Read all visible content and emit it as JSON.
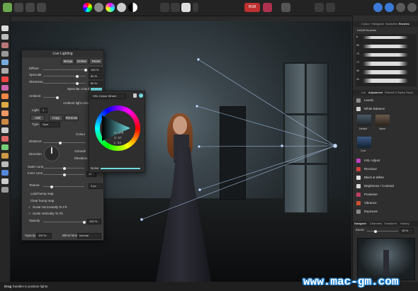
{
  "toolbar": {
    "icons": [
      "persona-photo-icon",
      "persona-liquify-icon",
      "persona-develop-icon",
      "persona-tonemap-icon",
      "persona-export-icon",
      "color-wheel-icon",
      "levels-icon",
      "hsl-icon",
      "white-balance-icon",
      "auto-contrast-icon",
      "select-rect-icon",
      "select-ellipse-icon",
      "mask-icon",
      "rgb-icon",
      "quick-mask-icon",
      "refine-icon",
      "assistant-icon",
      "snapping-icon",
      "arrange-icon",
      "view-mode-icon"
    ],
    "channel_label": "RGB"
  },
  "live_lighting": {
    "title": "Live Lighting",
    "merge": "Merge",
    "delete": "Delete",
    "reset": "Reset",
    "diffuse_label": "Diffuse",
    "diffuse_value": "100 %",
    "specular_label": "Specular",
    "specular_value": "80 %",
    "shininess_label": "Shininess",
    "shininess_value": "80 %",
    "specular_colour_label": "Specular colour",
    "ambient_label": "Ambient",
    "ambient_light_colour_label": "Ambient light colour",
    "light_label": "Light",
    "light_value": "1",
    "add": "Add",
    "copy": "Copy",
    "remove": "Remove",
    "type_label": "Type",
    "type_value": "Spot",
    "colour_label": "Colour",
    "distance_label": "Distance",
    "direction_label": "Direction",
    "azimuth_label": "Azimuth",
    "elevation_label": "Elevation",
    "outer_cone_label": "Outer cone",
    "inner_cone_label": "Inner cone",
    "inner_cone_value": "16 °",
    "texture_label": "Texture",
    "texture_value": "9 px",
    "load_bump_map": "Load bump map",
    "clear_bump_map": "Clear bump map",
    "scale_h": "Scale Horizontally To Fit",
    "scale_v": "Scale Vertically To Fit",
    "opacity_slider_label": "Opacity",
    "opacity_slider_value": "100 %",
    "opacity_label": "Opacity",
    "opacity_value": "100 %",
    "blend_mode_label": "Blend Mode",
    "blend_mode_value": "Normal"
  },
  "colour_popup": {
    "mode": "HSL Colour Wheel",
    "h": "H: 179",
    "s": "S: 57",
    "l": "L: 84",
    "noise_label": "Noise"
  },
  "right_panel": {
    "top_tabs": [
      "Colour",
      "Histogram",
      "Swatches",
      "Brushes"
    ],
    "brush_category": "DAUB Brushes",
    "brush_sizes": [
      "8",
      "55",
      "75",
      "72",
      "96",
      "44"
    ],
    "mid_tabs": [
      "Lat",
      "Adjustment",
      "Effects",
      "FX",
      "Styles",
      "Stock"
    ],
    "adjustments": [
      {
        "label": "Levels",
        "color": "#8a8a8a"
      },
      {
        "label": "White Balance",
        "color": "#d0d0d0"
      },
      {
        "label": "HSL Adjust",
        "color": "#c040c0"
      },
      {
        "label": "Recolour",
        "color": "#d04040"
      },
      {
        "label": "Black & White",
        "color": "#e0e0e0"
      },
      {
        "label": "Brightness / Contrast",
        "color": "#d8d8d8"
      },
      {
        "label": "Posterise",
        "color": "#c04060"
      },
      {
        "label": "Vibrance",
        "color": "#d05030"
      },
      {
        "label": "Exposure",
        "color": "#888888"
      }
    ],
    "wb_presets": [
      "Default",
      "Warm"
    ],
    "wb_preset_cool": "Cool",
    "bottom_tabs": [
      "Navigator",
      "Channels",
      "Transform",
      "History"
    ],
    "zoom_label": "Zoom:",
    "zoom_value": "18 %"
  },
  "status": {
    "bold": "Drag",
    "rest": "handles to position lights."
  },
  "watermark": {
    "url": "www.mac-gm.com",
    "outline_color": "#1e7ecf"
  }
}
